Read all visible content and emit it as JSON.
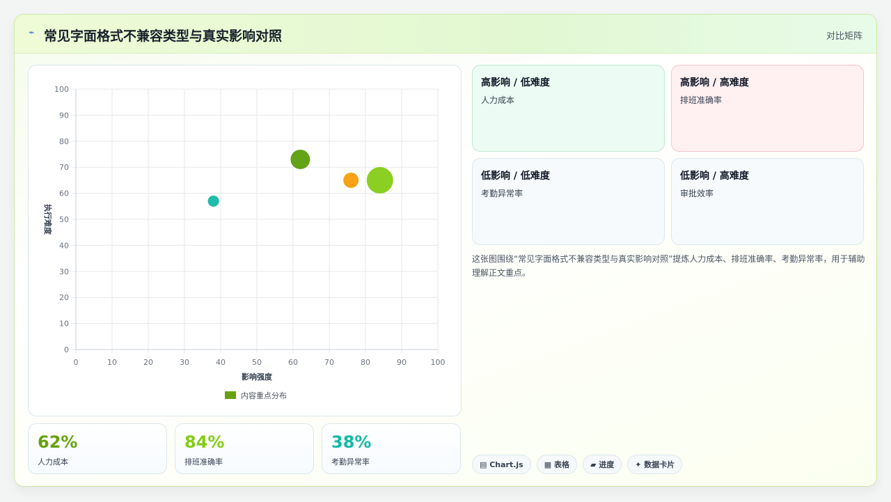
{
  "header": {
    "icon": "lightning-icon",
    "title": "常见字面格式不兼容类型与真实影响对照",
    "tag": "对比矩阵"
  },
  "chart_data": {
    "type": "scatter",
    "xlabel": "影响强度",
    "ylabel": "执行难度",
    "xlim": [
      0,
      100
    ],
    "ylim": [
      0,
      100
    ],
    "xticks": [
      0,
      10,
      20,
      30,
      40,
      50,
      60,
      70,
      80,
      90,
      100
    ],
    "yticks": [
      0,
      10,
      20,
      30,
      40,
      50,
      60,
      70,
      80,
      90,
      100
    ],
    "grid": true,
    "legend_position": "bottom",
    "series": [
      {
        "name": "内容重点分布",
        "legend_color": "#65a30d",
        "points": [
          {
            "x": 38,
            "y": 57,
            "r": 8,
            "color": "#14b8a6"
          },
          {
            "x": 62,
            "y": 73,
            "r": 14,
            "color": "#5b9e0c"
          },
          {
            "x": 76,
            "y": 65,
            "r": 11,
            "color": "#f59e0b"
          },
          {
            "x": 84,
            "y": 65,
            "r": 19,
            "color": "#84cc16"
          }
        ]
      }
    ]
  },
  "stats": [
    {
      "value": "62%",
      "label": "人力成本",
      "color": "#65a30d"
    },
    {
      "value": "84%",
      "label": "排班准确率",
      "color": "#84cc16"
    },
    {
      "value": "38%",
      "label": "考勤异常率",
      "color": "#14b8a6"
    }
  ],
  "quadrants": [
    {
      "heading": "高影响 / 低难度",
      "item": "人力成本",
      "bg": "#ecfbf3",
      "border": "#bfe9cf"
    },
    {
      "heading": "高影响 / 高难度",
      "item": "排班准确率",
      "bg": "#fff0f1",
      "border": "#f3c6cb"
    },
    {
      "heading": "低影响 / 低难度",
      "item": "考勤异常率",
      "bg": "#f6fafd",
      "border": "#dbe7ea"
    },
    {
      "heading": "低影响 / 高难度",
      "item": "审批效率",
      "bg": "#f6fafd",
      "border": "#dbe7ea"
    }
  ],
  "description": "这张图围绕“常见字面格式不兼容类型与真实影响对照”提炼人力成本、排班准确率、考勤异常率，用于辅助理解正文重点。",
  "chips": [
    {
      "icon": "chart-icon",
      "label": "▤ Chart.js"
    },
    {
      "icon": "table-icon",
      "label": "▦ 表格"
    },
    {
      "icon": "progress-icon",
      "label": "▰ 进度"
    },
    {
      "icon": "card-icon",
      "label": "✦ 数据卡片"
    }
  ]
}
